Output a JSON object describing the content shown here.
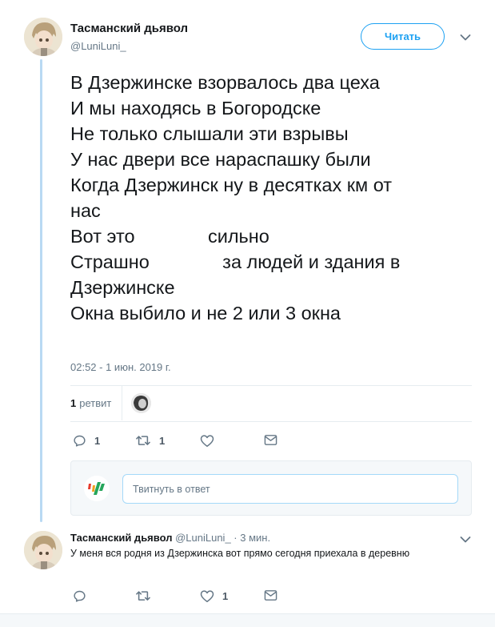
{
  "tweet": {
    "author_name": "Тасманский дьявол",
    "author_handle": "@LuniLuni_",
    "follow_label": "Читать",
    "text_lines": [
      "В Дзержинске взорвалось два цеха",
      "И мы находясь в Богородске",
      "Не только слышали эти взрывы",
      "У нас двери все нараспашку были",
      "Когда Дзержинск ну в десятках км от",
      "нас",
      "Вот это              сильно",
      "Страшно              за людей и здания в",
      "Дзержинске",
      "Окна выбило и не 2 или 3 окна"
    ],
    "timestamp": "02:52 - 1 июн. 2019 г.",
    "retweet_count": "1",
    "retweet_label": "ретвит",
    "actions": {
      "reply_count": "1",
      "retweet_count": "1",
      "like_count": ""
    }
  },
  "reply_box": {
    "placeholder": "Твитнуть в ответ"
  },
  "reply": {
    "author_name": "Тасманский дьявол",
    "meta": "@LuniLuni_ · 3 мин.",
    "text": "У меня вся родня из Дзержинска вот прямо сегодня приехала в деревню",
    "actions": {
      "reply_count": "",
      "retweet_count": "",
      "like_count": "1"
    }
  },
  "colors": {
    "accent": "#1da1f2",
    "thread_line": "#b9d9f3",
    "muted_text": "#657786"
  }
}
